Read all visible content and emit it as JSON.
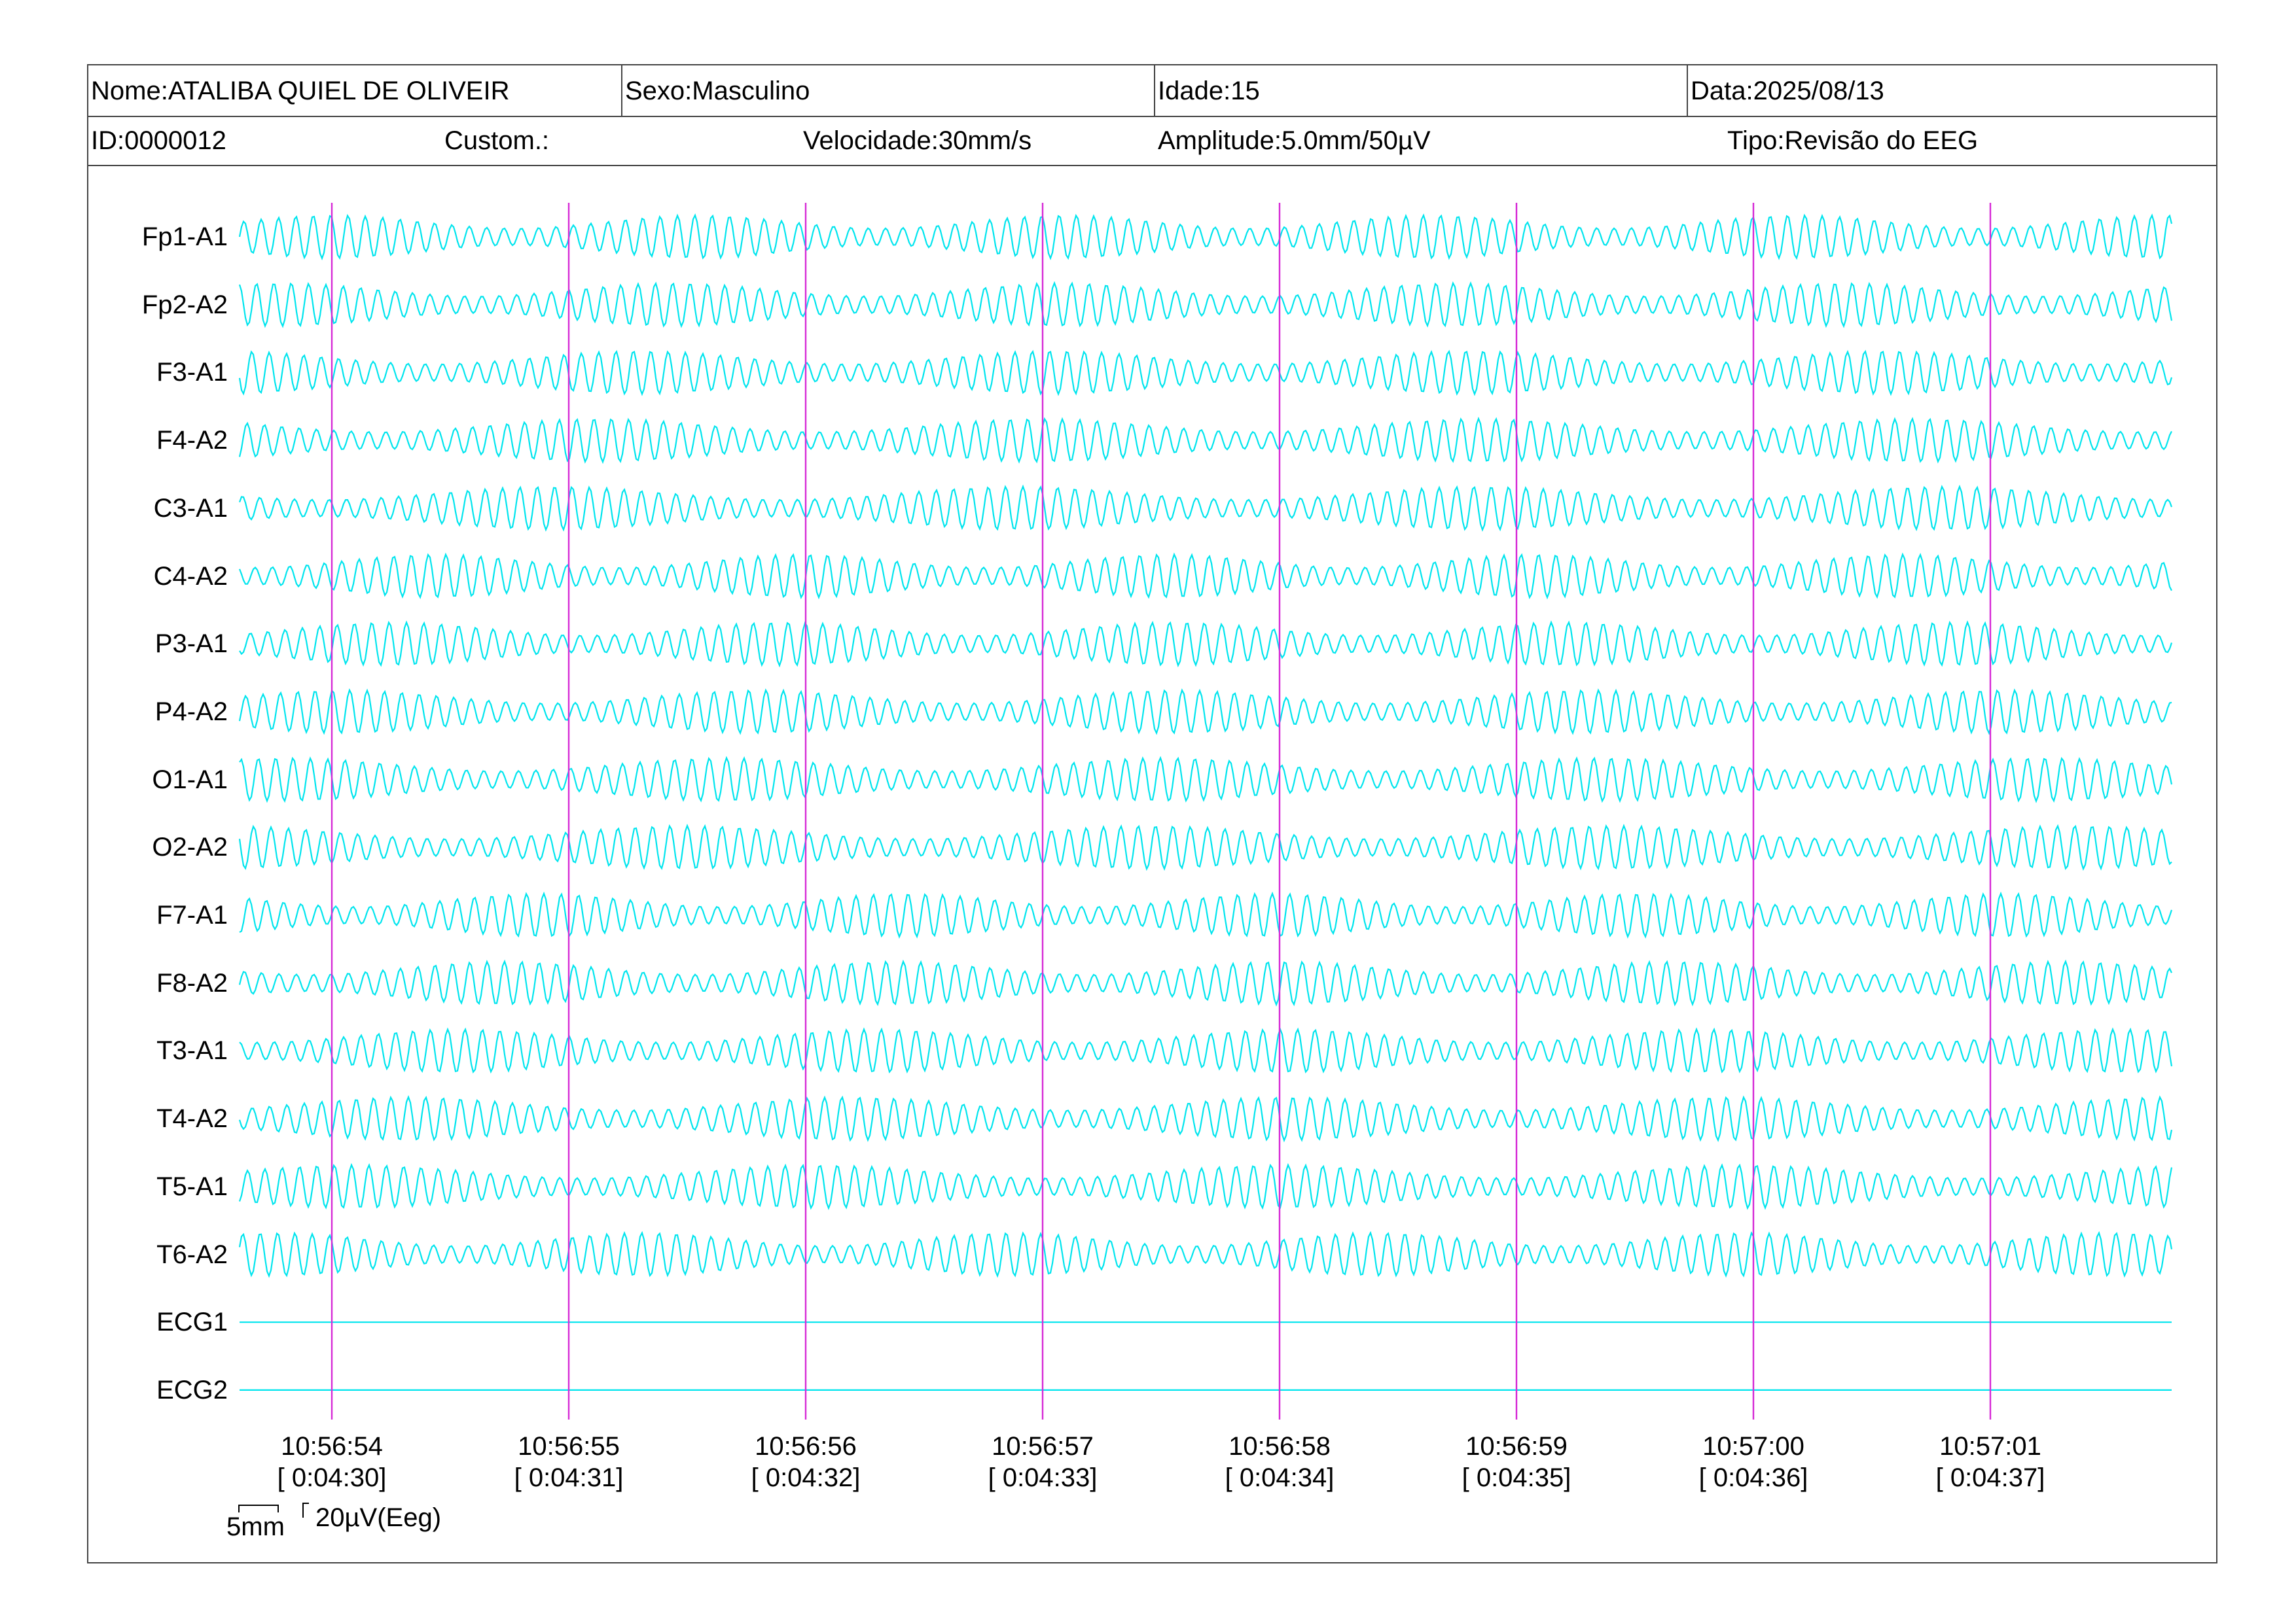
{
  "header": {
    "name_label": "Nome:",
    "name": "ATALIBA QUIEL DE OLIVEIR",
    "sex_label": "Sexo:",
    "sex": "Masculino",
    "age_label": "Idade:",
    "age": "15",
    "date_label": "Data:",
    "date": "2025/08/13",
    "id_label": "ID:",
    "id": "0000012",
    "custom_label": "Custom.:",
    "custom": "",
    "speed_label": "Velocidade:",
    "speed": "30mm/s",
    "amplitude_label": "Amplitude:",
    "amplitude": "5.0mm/50µV",
    "type_label": "Tipo:",
    "type": "Revisão do EEG"
  },
  "channels": [
    {
      "label": "Fp1-A1",
      "kind": "eeg"
    },
    {
      "label": "Fp2-A2",
      "kind": "eeg"
    },
    {
      "label": "F3-A1",
      "kind": "eeg"
    },
    {
      "label": "F4-A2",
      "kind": "eeg"
    },
    {
      "label": "C3-A1",
      "kind": "eeg"
    },
    {
      "label": "C4-A2",
      "kind": "eeg"
    },
    {
      "label": "P3-A1",
      "kind": "eeg"
    },
    {
      "label": "P4-A2",
      "kind": "eeg"
    },
    {
      "label": "O1-A1",
      "kind": "eeg"
    },
    {
      "label": "O2-A2",
      "kind": "eeg"
    },
    {
      "label": "F7-A1",
      "kind": "eeg"
    },
    {
      "label": "F8-A2",
      "kind": "eeg"
    },
    {
      "label": "T3-A1",
      "kind": "eeg"
    },
    {
      "label": "T4-A2",
      "kind": "eeg"
    },
    {
      "label": "T5-A1",
      "kind": "eeg"
    },
    {
      "label": "T6-A2",
      "kind": "eeg"
    },
    {
      "label": "ECG1",
      "kind": "ecg"
    },
    {
      "label": "ECG2",
      "kind": "ecg"
    }
  ],
  "time_markers": [
    {
      "clock": "10:56:54",
      "elapsed": "[ 0:04:30]"
    },
    {
      "clock": "10:56:55",
      "elapsed": "[ 0:04:31]"
    },
    {
      "clock": "10:56:56",
      "elapsed": "[ 0:04:32]"
    },
    {
      "clock": "10:56:57",
      "elapsed": "[ 0:04:33]"
    },
    {
      "clock": "10:56:58",
      "elapsed": "[ 0:04:34]"
    },
    {
      "clock": "10:56:59",
      "elapsed": "[ 0:04:35]"
    },
    {
      "clock": "10:57:00",
      "elapsed": "[ 0:04:36]"
    },
    {
      "clock": "10:57:01",
      "elapsed": "[ 0:04:37]"
    }
  ],
  "scale": {
    "time_label": "5mm",
    "amp_label": "20µV(Eeg)"
  },
  "colors": {
    "trace": "#00e5ee",
    "marker": "#d62ad6",
    "border": "#444444"
  }
}
